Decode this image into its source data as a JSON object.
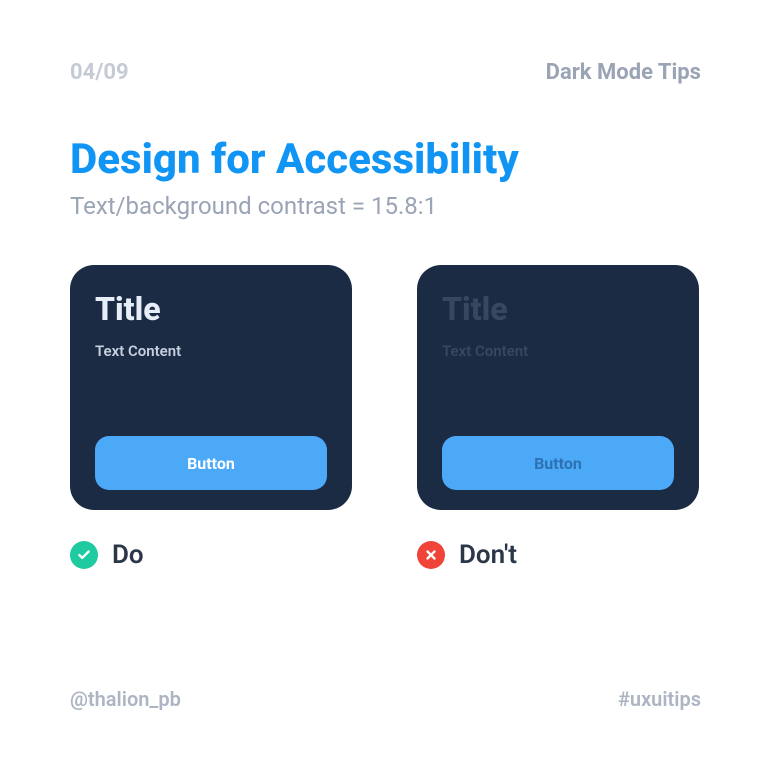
{
  "header": {
    "page_number": "04/09",
    "category": "Dark Mode Tips"
  },
  "main": {
    "title": "Design for Accessibility",
    "subtitle": "Text/background contrast = 15.8:1"
  },
  "cards": {
    "do": {
      "title": "Title",
      "text": "Text Content",
      "button": "Button"
    },
    "dont": {
      "title": "Title",
      "text": "Text Content",
      "button": "Button"
    }
  },
  "labels": {
    "do": "Do",
    "dont": "Don't"
  },
  "footer": {
    "handle": "@thalion_pb",
    "hashtag": "#uxuitips"
  }
}
